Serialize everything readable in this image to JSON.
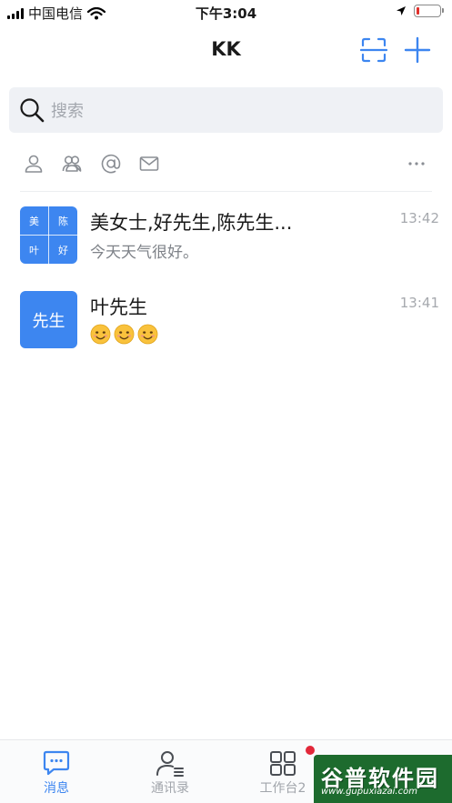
{
  "status_bar": {
    "carrier": "中国电信",
    "time": "下午3:04",
    "battery_level": 0.12,
    "battery_color": "#e1302b"
  },
  "nav": {
    "title": "KK",
    "scan_icon": "scan-icon",
    "add_icon": "plus-icon"
  },
  "search": {
    "placeholder": "搜索",
    "icon": "search-icon"
  },
  "filters": {
    "icons": [
      "person-icon",
      "group-icon",
      "at-icon",
      "mail-icon",
      "more-icon"
    ]
  },
  "conversations": [
    {
      "avatar_cells": [
        "美",
        "陈",
        "叶",
        "好"
      ],
      "name": "美女士,好先生,陈先生...",
      "preview": "今天天气很好。",
      "time": "13:42"
    },
    {
      "avatar_text": "先生",
      "name": "叶先生",
      "preview_emojis": [
        "smiley-emoji",
        "smiley-emoji",
        "smiley-emoji"
      ],
      "time": "13:41"
    }
  ],
  "tabbar": {
    "tabs": [
      {
        "label": "消息",
        "icon": "chat-icon",
        "active": true
      },
      {
        "label": "通讯录",
        "icon": "contacts-icon",
        "active": false
      },
      {
        "label": "工作台2",
        "icon": "workbench-icon",
        "active": false,
        "badge": true
      }
    ]
  },
  "watermark": {
    "main": "谷普软件园",
    "url": "www.gupuxiazai.com"
  },
  "colors": {
    "accent": "#3d86f0",
    "badge": "#e2283a",
    "inactive": "#a1a5ab"
  }
}
